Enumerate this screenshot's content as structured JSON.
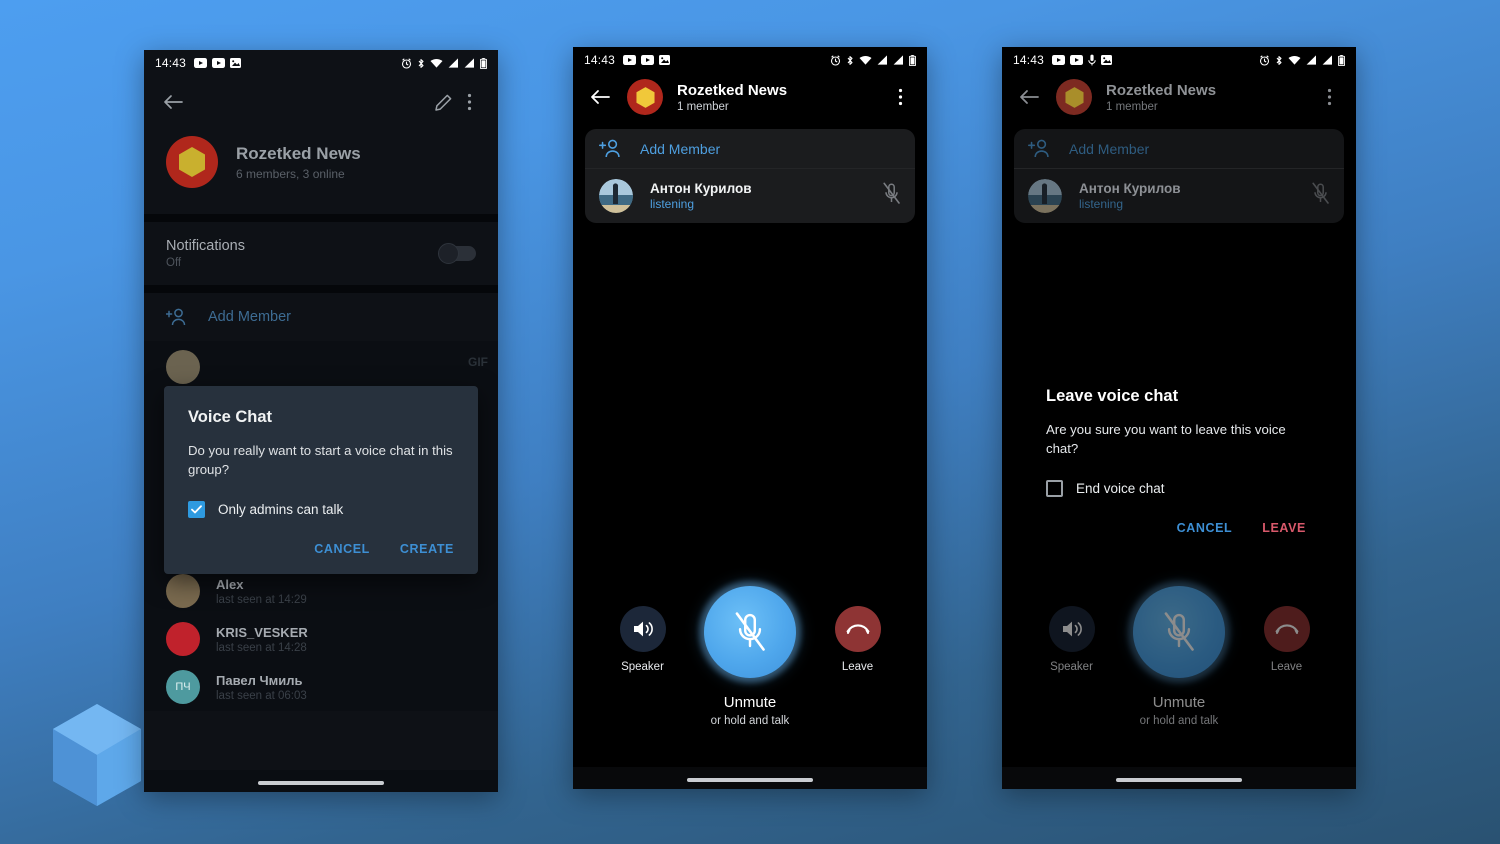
{
  "theme": {
    "accent_blue": "#4e9fe0",
    "dialog_bg": "#27313d",
    "danger_red": "#d9596b",
    "avatar_red": "#b0271c",
    "avatar_hex_yellow": "#c9b02e",
    "mic_blue": "#4fa7ec"
  },
  "statusbar": {
    "time": "14:43",
    "left_icons": [
      "youtube-icon",
      "youtube-icon",
      "image-icon"
    ],
    "left_icons_phone3": [
      "youtube-icon",
      "youtube-icon",
      "microphone-icon",
      "image-icon"
    ],
    "right_icons": [
      "alarm-icon",
      "bluetooth-icon",
      "wifi-icon",
      "signal-icon",
      "signal-icon",
      "battery-icon"
    ]
  },
  "phone1": {
    "appbar": {
      "back_icon": "arrow-left-icon",
      "edit_icon": "pencil-icon",
      "overflow_icon": "more-vertical-icon"
    },
    "profile": {
      "name": "Rozetked News",
      "subtitle": "6 members, 3 online",
      "avatar": "hexagon-group-avatar"
    },
    "notifications": {
      "label": "Notifications",
      "value": "Off",
      "toggle_state": "off"
    },
    "add_member": {
      "label": "Add Member",
      "icon": "add-person-icon"
    },
    "behind_label": "GIF",
    "dialog": {
      "title": "Voice Chat",
      "message": "Do you really want to start a voice chat in this group?",
      "checkbox_label": "Only admins can talk",
      "checkbox_checked": true,
      "cancel_label": "CANCEL",
      "confirm_label": "CREATE"
    },
    "contacts": [
      {
        "name": "Alex",
        "status": "last seen at 14:29",
        "avatar_color": "#7a6a4f",
        "initials": ""
      },
      {
        "name": "KRIS_VESKER",
        "status": "last seen at 14:28",
        "avatar_color": "#c0222c",
        "initials": ""
      },
      {
        "name": "Павел Чмиль",
        "status": "last seen at 06:03",
        "avatar_color": "#4e9a9f",
        "initials": "ПЧ"
      }
    ]
  },
  "phone2": {
    "appbar": {
      "back_icon": "arrow-left-icon",
      "title": "Rozetked News",
      "subtitle": "1 member",
      "overflow_icon": "more-vertical-icon"
    },
    "add_member": {
      "label": "Add Member",
      "icon": "add-person-icon"
    },
    "member": {
      "name": "Антон Курилов",
      "status": "listening",
      "mic_icon": "mic-off-icon"
    },
    "controls": {
      "speaker_label": "Speaker",
      "speaker_icon": "speaker-icon",
      "leave_label": "Leave",
      "leave_icon": "phone-hangup-icon",
      "mic_icon": "mic-off-icon",
      "mic_label": "Unmute",
      "mic_sublabel": "or hold and talk"
    }
  },
  "phone3": {
    "appbar": {
      "back_icon": "arrow-left-icon",
      "title": "Rozetked News",
      "subtitle": "1 member",
      "overflow_icon": "more-vertical-icon"
    },
    "add_member": {
      "label": "Add Member",
      "icon": "add-person-icon"
    },
    "member": {
      "name": "Антон Курилов",
      "status": "listening",
      "mic_icon": "mic-off-icon"
    },
    "dialog": {
      "title": "Leave voice chat",
      "message": "Are you sure you want to leave this voice chat?",
      "checkbox_label": "End voice chat",
      "checkbox_checked": false,
      "cancel_label": "CANCEL",
      "confirm_label": "LEAVE"
    },
    "controls": {
      "speaker_label": "Speaker",
      "speaker_icon": "speaker-icon",
      "leave_label": "Leave",
      "leave_icon": "phone-hangup-icon",
      "mic_icon": "mic-off-icon",
      "mic_label": "Unmute",
      "mic_sublabel": "or hold and talk"
    }
  },
  "watermark": {
    "name": "cube-logo"
  }
}
